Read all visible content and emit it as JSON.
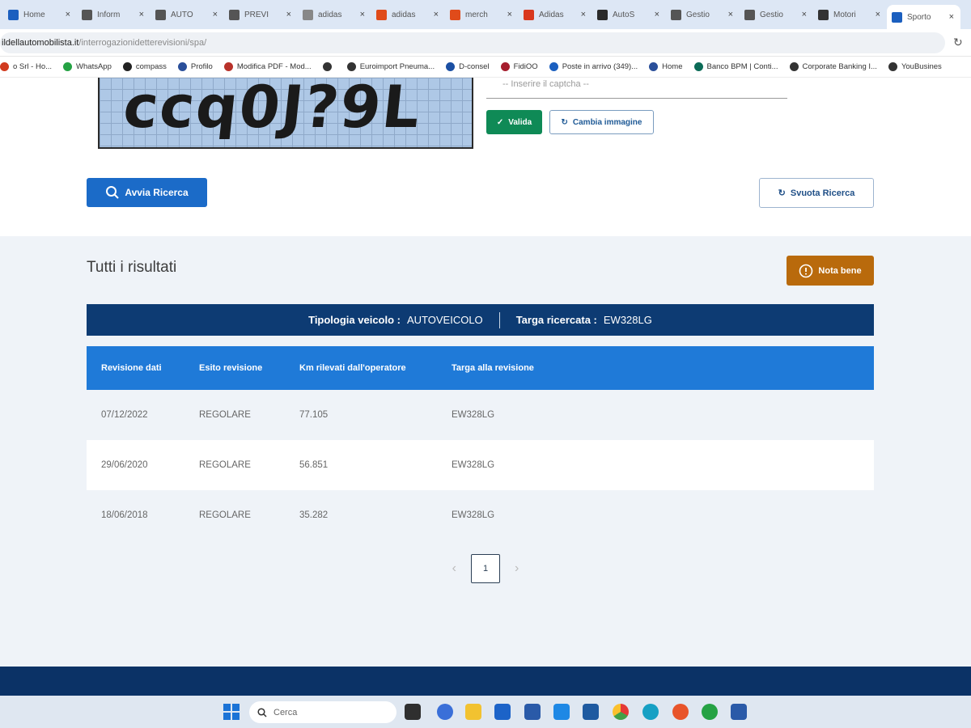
{
  "browser": {
    "tabs": [
      {
        "label": "Home",
        "color": "#1b5fbf"
      },
      {
        "label": "Inform",
        "color": "#555555"
      },
      {
        "label": "AUTO",
        "color": "#555555"
      },
      {
        "label": "PREVI",
        "color": "#555555"
      },
      {
        "label": "adidas",
        "color": "#888888"
      },
      {
        "label": "adidas",
        "color": "#e04b1a"
      },
      {
        "label": "merch",
        "color": "#e04b1a"
      },
      {
        "label": "Adidas",
        "color": "#d9381e"
      },
      {
        "label": "AutoS",
        "color": "#2b2b2b"
      },
      {
        "label": "Gestio",
        "color": "#555555"
      },
      {
        "label": "Gestio",
        "color": "#555555"
      },
      {
        "label": "Motori",
        "color": "#333333"
      },
      {
        "label": "Sporto",
        "color": "#1b5fbf"
      }
    ],
    "url_host": "ildellautomobilista.it",
    "url_path": "/interrogazionidetterevisioni/spa/",
    "bookmarks": [
      {
        "label": "o Srl - Ho...",
        "color": "#d13b1f"
      },
      {
        "label": "WhatsApp",
        "color": "#25a244"
      },
      {
        "label": "compass",
        "color": "#222222"
      },
      {
        "label": "Profilo",
        "color": "#2a4f9a"
      },
      {
        "label": "Modifica PDF - Mod...",
        "color": "#b8322a"
      },
      {
        "label": "",
        "color": "#333333"
      },
      {
        "label": "Euroimport Pneuma...",
        "color": "#333333"
      },
      {
        "label": "D-consel",
        "color": "#1b4fa3"
      },
      {
        "label": "FidiOO",
        "color": "#a51d2d"
      },
      {
        "label": "Poste in arrivo (349)...",
        "color": "#1b5fbf"
      },
      {
        "label": "Home",
        "color": "#2a4f9a"
      },
      {
        "label": "Banco BPM | Conti...",
        "color": "#0b6b57"
      },
      {
        "label": "Corporate Banking I...",
        "color": "#333333"
      },
      {
        "label": "YouBusines",
        "color": "#333333"
      }
    ]
  },
  "captcha": {
    "text": "ccq0J?9L",
    "input_placeholder": "-- Inserire il captcha --",
    "valida_label": "Valida",
    "cambia_label": "Cambia immagine"
  },
  "search": {
    "avvia_label": "Avvia Ricerca",
    "svuota_label": "Svuota Ricerca"
  },
  "results": {
    "title": "Tutti i risultati",
    "nota_label": "Nota bene",
    "tipologia_label": "Tipologia veicolo :",
    "tipologia_value": "AUTOVEICOLO",
    "targa_label": "Targa ricercata :",
    "targa_value": "EW328LG",
    "columns": [
      "Revisione dati",
      "Esito revisione",
      "Km rilevati dall'operatore",
      "Targa alla revisione"
    ],
    "rows": [
      [
        "07/12/2022",
        "REGOLARE",
        "77.105",
        "EW328LG"
      ],
      [
        "29/06/2020",
        "REGOLARE",
        "56.851",
        "EW328LG"
      ],
      [
        "18/06/2018",
        "REGOLARE",
        "35.282",
        "EW328LG"
      ]
    ],
    "page": "1"
  },
  "taskbar": {
    "search_placeholder": "Cerca"
  }
}
